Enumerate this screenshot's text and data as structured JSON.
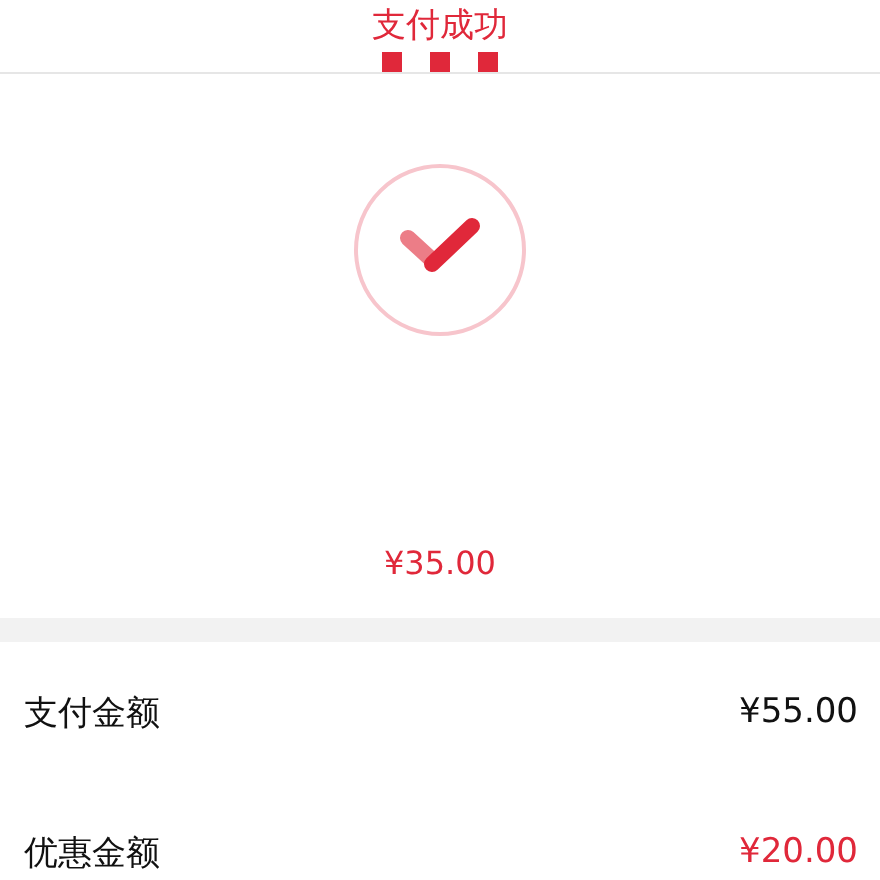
{
  "header": {
    "title": "支付成功"
  },
  "result": {
    "amount": "¥35.00"
  },
  "details": [
    {
      "label": "支付金额",
      "value": "¥55.00",
      "highlighted": false
    },
    {
      "label": "优惠金额",
      "value": "¥20.00",
      "highlighted": true
    }
  ]
}
